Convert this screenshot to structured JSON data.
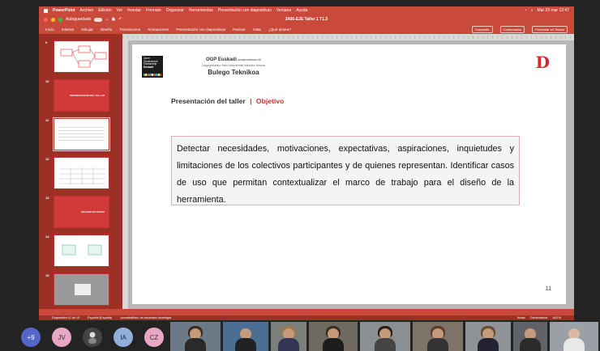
{
  "menubar": {
    "app": "PowerPoint",
    "items": [
      "Archivo",
      "Edición",
      "Ver",
      "Insertar",
      "Formato",
      "Organizar",
      "Herramientas",
      "Presentación con diapositivas",
      "Ventana",
      "Ayuda"
    ],
    "clock": "Mar 29 mar  12:47"
  },
  "titlebar": {
    "autosave": "Autoguardado",
    "doc_title": "2406-EJE Taller 1 T1.3"
  },
  "ribbon": {
    "tabs": [
      "Inicio",
      "Insertar",
      "Dibujar",
      "Diseño",
      "Transiciones",
      "Animaciones",
      "Presentación con diapositivas",
      "Revisar",
      "Vista",
      "¿Qué desea?"
    ],
    "share": "Compartir",
    "comments": "Comentarios",
    "present_teams": "Presentar en Teams"
  },
  "thumbnails": [
    {
      "num": "9",
      "style": "diagram"
    },
    {
      "num": "10",
      "style": "red",
      "text": "PRESENTACIÓN DEL TALLER"
    },
    {
      "num": "11",
      "style": "lines"
    },
    {
      "num": "12",
      "style": "table"
    },
    {
      "num": "13",
      "style": "red",
      "text": "SIGUIENTES PASOS"
    },
    {
      "num": "14",
      "style": "boxes"
    },
    {
      "num": "15",
      "style": "photo"
    }
  ],
  "slide": {
    "logo_text": [
      "Open",
      "Government",
      "Partnership",
      "Euskadi"
    ],
    "ogp_line1": "OGP Euskadi",
    "ogp_line1_small": "konpromisoa #4",
    "ogp_line2": "Legegintzako herri-ekimenak biltzeko tresna",
    "ogp_line3": "Bulego Teknikoa",
    "brand": "D",
    "heading": "Presentación del taller",
    "separator": "|",
    "heading_red": "Objetivo",
    "body": "Detectar necesidades, motivaciones, expectativas, aspiraciones, inquietudes y limitaciones de los colectivos participantes y de quienes representan. Identificar casos de uso que permitan contextualizar el marco de trabajo para el diseño de la herramienta.",
    "page_number": "11"
  },
  "statusbar": {
    "slide_info": "Diapositiva 11 de 15",
    "language": "Español (España)",
    "accessibility": "Accesibilidad: es necesario investigar",
    "notes": "Notas",
    "comments": "Comentarios",
    "zoom": "163 %"
  },
  "participants": {
    "extra": "+9",
    "initials": [
      "JV",
      "IA",
      "CZ"
    ]
  },
  "colors": {
    "accent": "#c94a3a",
    "brand_red": "#d12b2b"
  }
}
